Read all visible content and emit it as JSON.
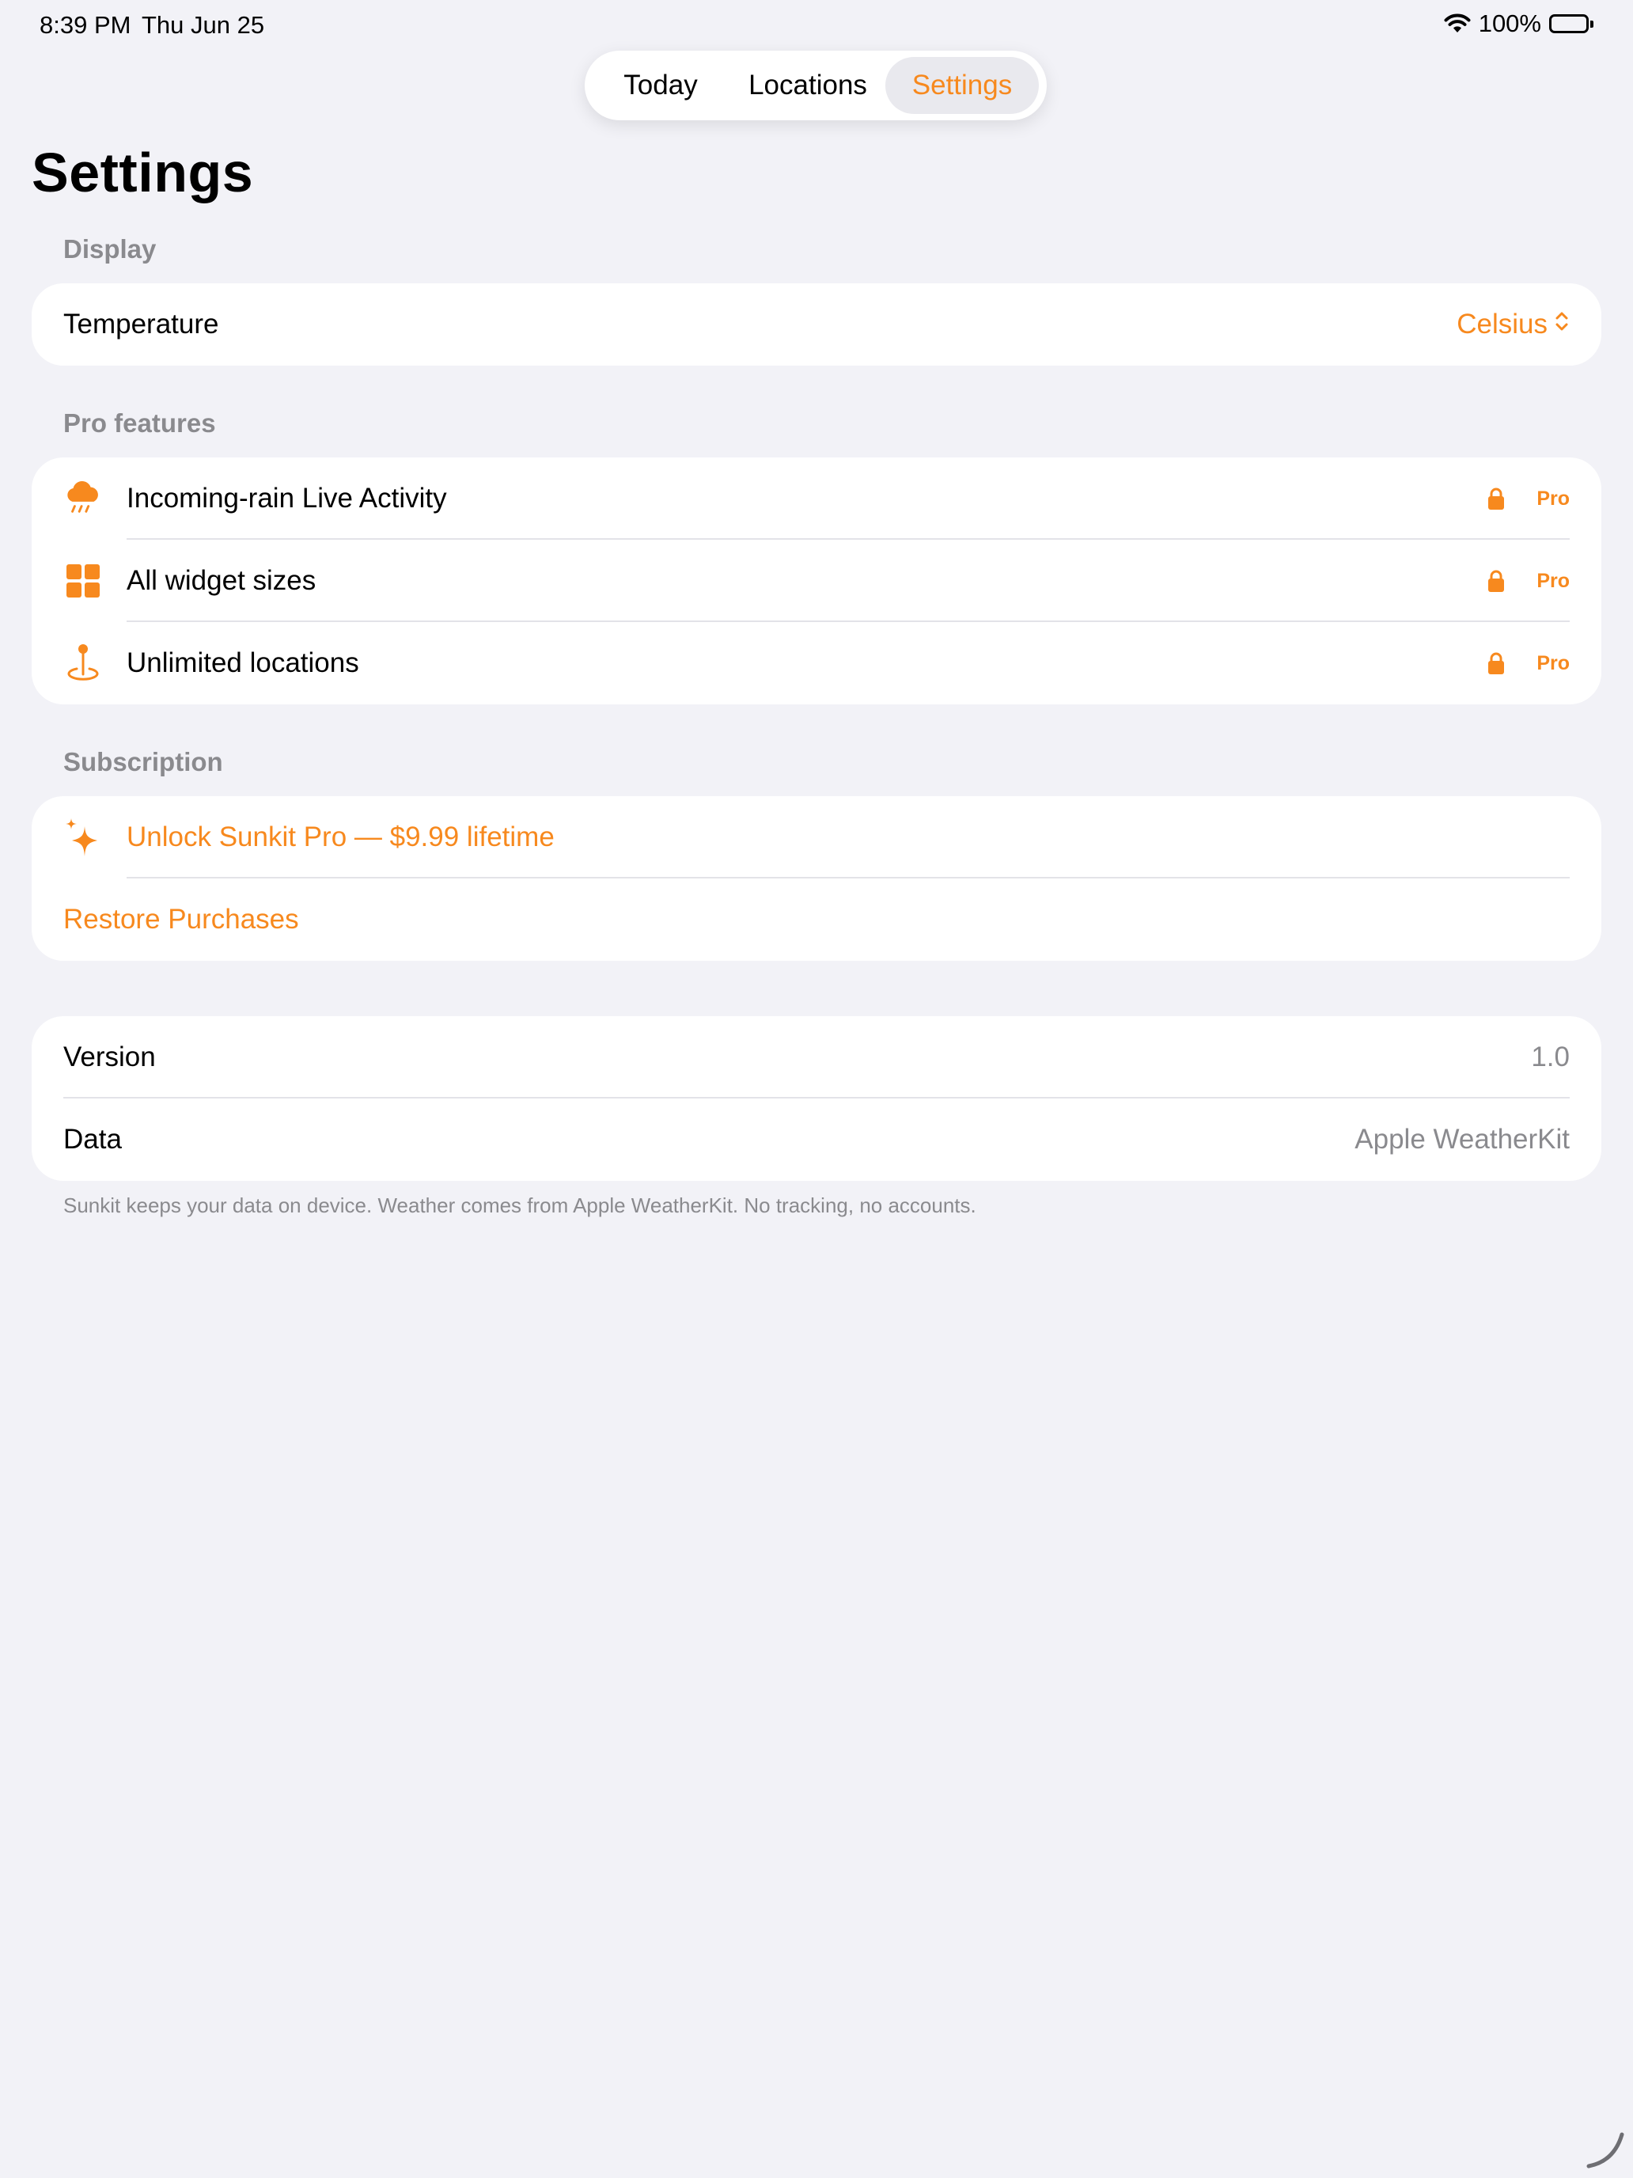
{
  "status_bar": {
    "time": "8:39 PM",
    "date": "Thu Jun 25",
    "battery": "100%"
  },
  "tabs": [
    {
      "label": "Today",
      "selected": false
    },
    {
      "label": "Locations",
      "selected": false
    },
    {
      "label": "Settings",
      "selected": true
    }
  ],
  "page_title": "Settings",
  "display": {
    "header": "Display",
    "temperature_label": "Temperature",
    "temperature_value": "Celsius"
  },
  "pro_features": {
    "header": "Pro features",
    "items": [
      {
        "label": "Incoming-rain Live Activity",
        "icon": "cloud-rain-icon",
        "badge": "Pro"
      },
      {
        "label": "All widget sizes",
        "icon": "widget-grid-icon",
        "badge": "Pro"
      },
      {
        "label": "Unlimited locations",
        "icon": "map-pin-icon",
        "badge": "Pro"
      }
    ]
  },
  "subscription": {
    "header": "Subscription",
    "unlock_label": "Unlock Sunkit Pro — $9.99 lifetime",
    "restore_label": "Restore Purchases"
  },
  "about": {
    "version_label": "Version",
    "version_value": "1.0",
    "data_label": "Data",
    "data_value": "Apple WeatherKit"
  },
  "footnote": "Sunkit keeps your data on device. Weather comes from Apple WeatherKit. No tracking, no accounts.",
  "colors": {
    "accent": "#F7891E",
    "background": "#F2F2F7",
    "card": "#FFFFFF",
    "secondary_text": "#8A8A8E"
  }
}
